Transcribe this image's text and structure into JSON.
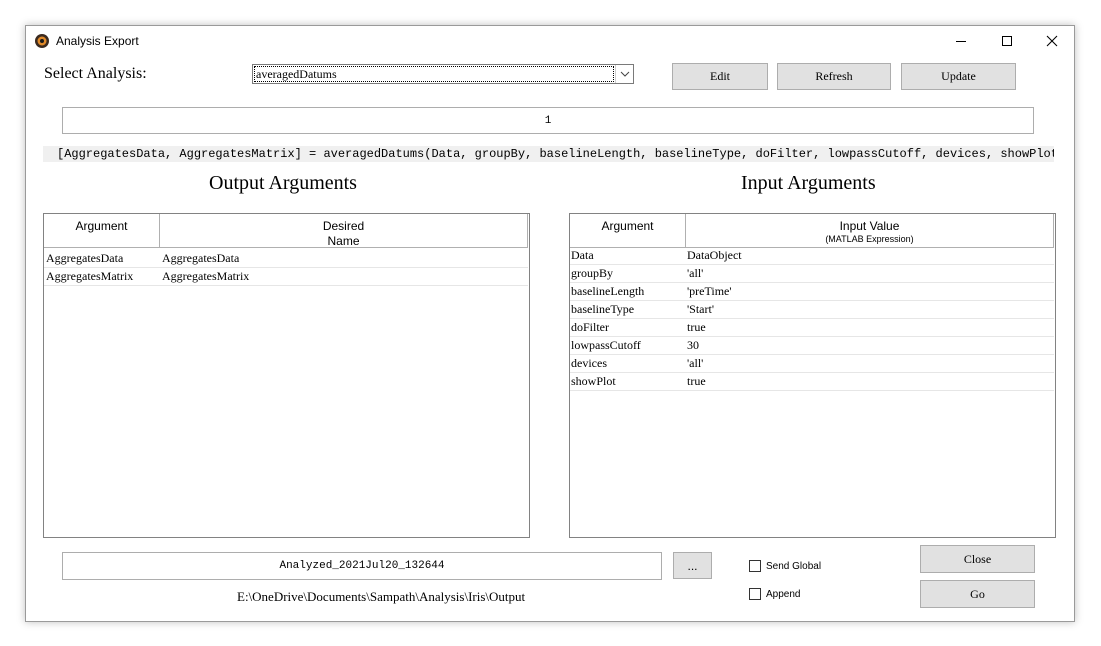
{
  "window": {
    "title": "Analysis Export"
  },
  "select": {
    "label": "Select Analysis:",
    "value": "averagedDatums"
  },
  "toolbar": {
    "edit": "Edit",
    "refresh": "Refresh",
    "update": "Update"
  },
  "counter": "1",
  "signature": "[AggregatesData, AggregatesMatrix] = averagedDatums(Data, groupBy, baselineLength, baselineType, doFilter, lowpassCutoff, devices, showPlot);",
  "output": {
    "title": "Output Arguments",
    "columns": {
      "argument": "Argument",
      "desired_1": "Desired",
      "desired_2": "Name"
    },
    "rows": [
      {
        "argument": "AggregatesData",
        "name": "AggregatesData"
      },
      {
        "argument": "AggregatesMatrix",
        "name": "AggregatesMatrix"
      }
    ]
  },
  "input": {
    "title": "Input Arguments",
    "columns": {
      "argument": "Argument",
      "value": "Input Value",
      "value_sub": "(MATLAB Expression)"
    },
    "rows": [
      {
        "argument": "Data",
        "value": "DataObject"
      },
      {
        "argument": "groupBy",
        "value": "'all'"
      },
      {
        "argument": "baselineLength",
        "value": "'preTime'"
      },
      {
        "argument": "baselineType",
        "value": "'Start'"
      },
      {
        "argument": "doFilter",
        "value": "true"
      },
      {
        "argument": "lowpassCutoff",
        "value": "30"
      },
      {
        "argument": "devices",
        "value": "'all'"
      },
      {
        "argument": "showPlot",
        "value": "true"
      }
    ]
  },
  "footer": {
    "filename": "Analyzed_2021Jul20_132644",
    "browse": "...",
    "path": "E:\\OneDrive\\Documents\\Sampath\\Analysis\\Iris\\Output",
    "send_global": "Send Global",
    "append": "Append",
    "close": "Close",
    "go": "Go"
  },
  "icons": {
    "app": "matlab-logo-icon",
    "minimize": "minimize-icon",
    "maximize": "maximize-icon",
    "close": "close-icon",
    "dropdown": "chevron-down-icon"
  }
}
